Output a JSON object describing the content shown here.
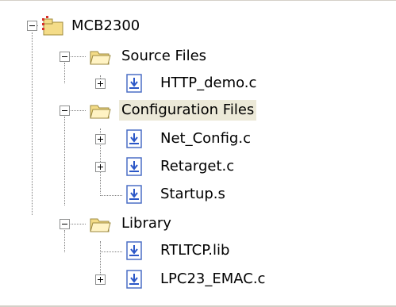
{
  "tree": {
    "root": {
      "label": "MCB2300",
      "icon": "project-icon",
      "expanded": true
    },
    "groups": [
      {
        "label": "Source Files",
        "icon": "folder-open-icon",
        "expanded": true,
        "files": [
          {
            "label": "HTTP_demo.c",
            "icon": "source-file-icon",
            "has_children": true
          }
        ]
      },
      {
        "label": "Configuration Files",
        "icon": "folder-open-icon",
        "expanded": true,
        "selected": true,
        "files": [
          {
            "label": "Net_Config.c",
            "icon": "source-file-icon",
            "has_children": true
          },
          {
            "label": "Retarget.c",
            "icon": "source-file-icon",
            "has_children": true
          },
          {
            "label": "Startup.s",
            "icon": "source-file-icon",
            "has_children": false
          }
        ]
      },
      {
        "label": "Library",
        "icon": "folder-open-icon",
        "expanded": true,
        "files": [
          {
            "label": "RTLTCP.lib",
            "icon": "library-file-icon",
            "has_children": false
          },
          {
            "label": "LPC23_EMAC.c",
            "icon": "source-file-icon",
            "has_children": true
          }
        ]
      }
    ]
  },
  "colors": {
    "selection_bg": "#ece9d8",
    "tree_lines": "#808080",
    "folder_yellow": "#f4dc88",
    "project_red": "#d8312a",
    "file_blue": "#2b57c7"
  }
}
